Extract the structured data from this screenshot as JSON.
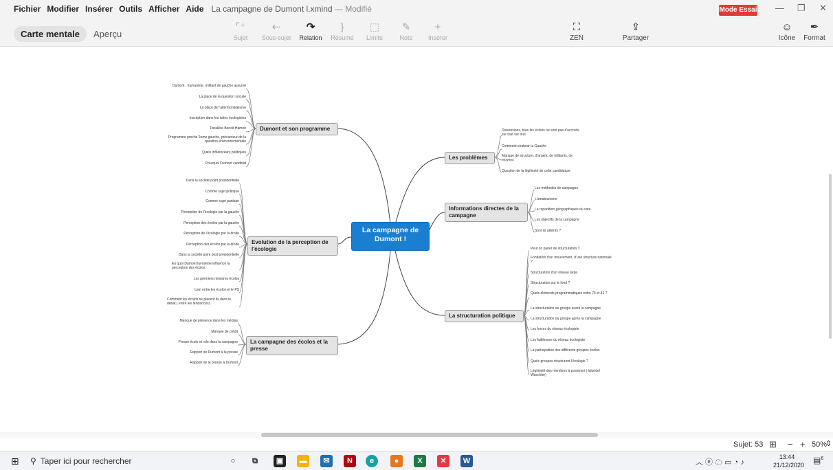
{
  "menu": [
    "Fichier",
    "Modifier",
    "Insérer",
    "Outils",
    "Afficher",
    "Aide"
  ],
  "document_title": "La campagne de Dumont l.xmind",
  "document_state": "— Modifié",
  "mode_badge": "Mode Essai",
  "tabs": {
    "active": "Carte mentale",
    "other": "Aperçu"
  },
  "toolbar": {
    "sujet": "Sujet",
    "sous_sujet": "Sous-sujet",
    "relation": "Relation",
    "resume": "Résumé",
    "limite": "Limite",
    "note": "Note",
    "inserer": "Insérer",
    "zen": "ZEN",
    "partager": "Partager",
    "icone": "Icône",
    "format": "Format"
  },
  "central": "La campagne de Dumont !",
  "branches": {
    "programme": {
      "label": "Dumont et son programme",
      "children": [
        "Dumont , humaniste, militant de gauche assumé",
        "La place de la question sociale",
        "La place de l'altermondialisme",
        "Inscription dans les luttes écologistes",
        "Parallèle Benoit Hamon",
        "Programme proche 2eme gauche, précurseur de la question environnementale",
        "Quels influenceurs politiques",
        "Pourquoi Dumont candidat"
      ]
    },
    "perception": {
      "label": "Evolution de la perception de l'écologie",
      "children": [
        "Dans la société point présidentielle",
        "Comme sujet politique",
        "Comme sujet partisan",
        "Perception de l'écologie par la gauche",
        "Perception des écolos par la gauche",
        "Perception de l'écologie par la droite",
        "Perception des écolos par la droite",
        "Dans la société point post présidentielle",
        "En quoi Dumont lui-même influence la perception des écolos",
        "Les premiers ministres écolos",
        "Lien entre les écolos et le PS",
        "Comment les écolos se placent ils dans le débat ( entre les tendances)"
      ]
    },
    "presse": {
      "label": "La campagne des écolos et la presse",
      "children": [
        "Manque de présence dans les médias",
        "Manque de crédit",
        "Presse écolo et role dans la campagne",
        "Rapport de Dumont à la presse",
        "Rapport de la presse à Dumont"
      ]
    },
    "problemes": {
      "label": "Les problèmes",
      "children": [
        "Dissensions, tous les écolos ne sont pas d'accords sur tout sur tout",
        "Comment soutenir la Gauche",
        "Manque de structure, d'argent, de militants, de moyens",
        "Question de la légitimité de cette candidature"
      ]
    },
    "informations": {
      "label": "Informations directes de la campagne",
      "children": [
        "Les méthodes de campagne",
        "L'amateurisme",
        "La répartition géographiques du vote",
        "Les objectifs de la campagne",
        "Sont ils atteints ?"
      ]
    },
    "structuration": {
      "label": "La structuration politique",
      "children": [
        "Peut on parler de structuration ?",
        "Fondation d'un mouvement, d'une structure nationale ?",
        "Structuration d'un réseau large",
        "Structuration sur le fond ?",
        "Quels éléments programmatiques entre 74 et 81 ?",
        "La structuration du groupe avant la campagne",
        "La structuration du groupe après la campagne",
        "Les forces du réseau écologiste",
        "Les faiblesses du réseau écologiste",
        "La participation des différents groupes écolos",
        "Quels groupes structurent l'écologie ?",
        "Légitimité des membres à posteriori ( lalonde/ Waechter)"
      ]
    }
  },
  "status": {
    "topics": "Sujet: 53",
    "zoom": "50%"
  },
  "taskbar": {
    "search_placeholder": "Taper ici pour rechercher",
    "time": "13:44",
    "date": "21/12/2020",
    "notif": "6"
  },
  "colors": {
    "central": "#1a7fd1",
    "branch_bg": "#e4e4e4",
    "mode_badge": "#e53935",
    "line": "#333333"
  }
}
